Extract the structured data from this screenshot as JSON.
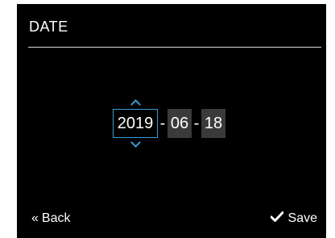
{
  "screen": {
    "title": "DATE"
  },
  "date": {
    "year": "2019",
    "separator": "-",
    "month": "06",
    "day": "18",
    "selected_field": "year"
  },
  "footer": {
    "back_icon": "double-chevron-left-icon",
    "back_label": "Back",
    "save_icon": "checkmark-icon",
    "save_label": "Save"
  },
  "colors": {
    "background": "#000000",
    "accent": "#3a9bd6",
    "field_bg": "#3a3a3a",
    "text": "#ffffff"
  }
}
